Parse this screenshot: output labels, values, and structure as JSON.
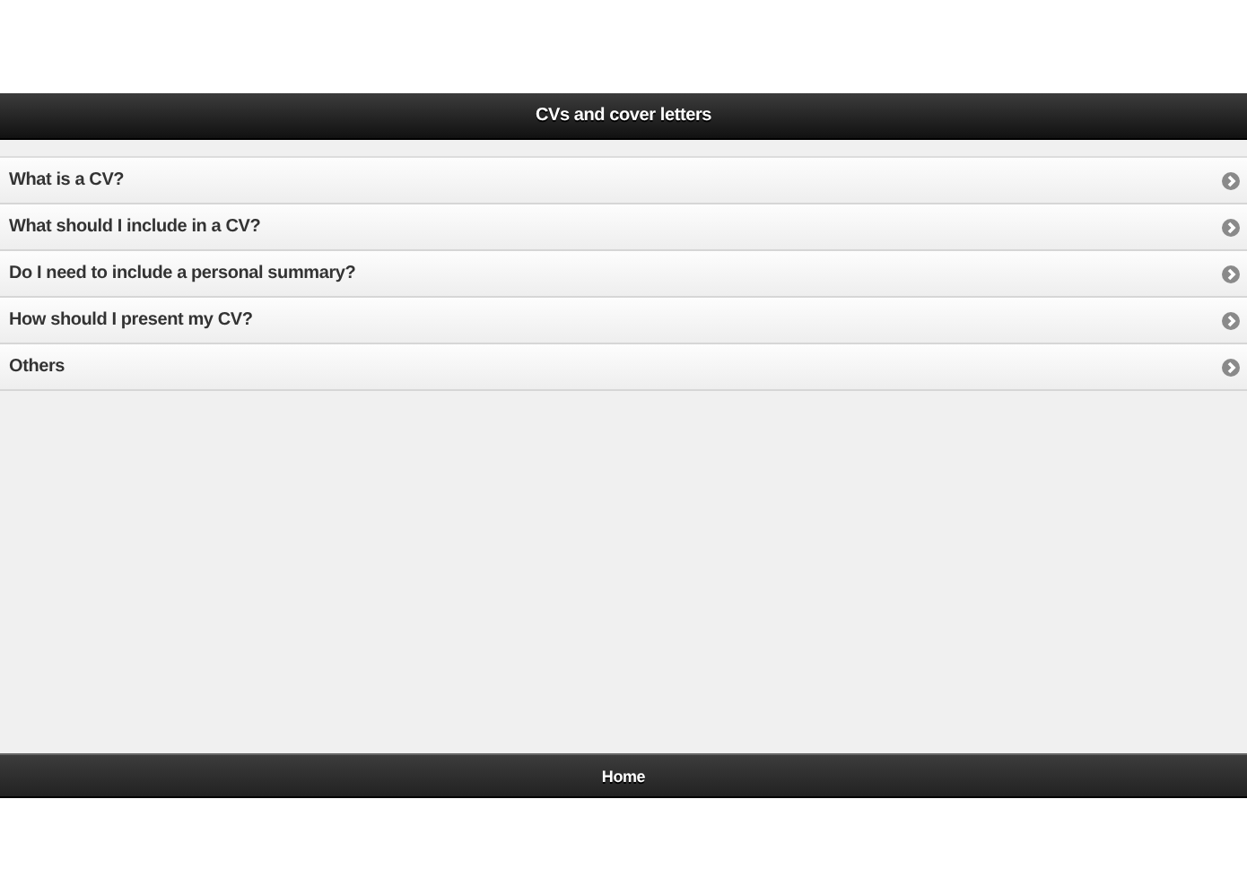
{
  "header": {
    "title": "CVs and cover letters"
  },
  "list": [
    {
      "label": "What is a CV?"
    },
    {
      "label": "What should I include in a CV?"
    },
    {
      "label": "Do I need to include a personal summary?"
    },
    {
      "label": "How should I present my CV?"
    },
    {
      "label": "Others"
    }
  ],
  "footer": {
    "label": "Home"
  }
}
